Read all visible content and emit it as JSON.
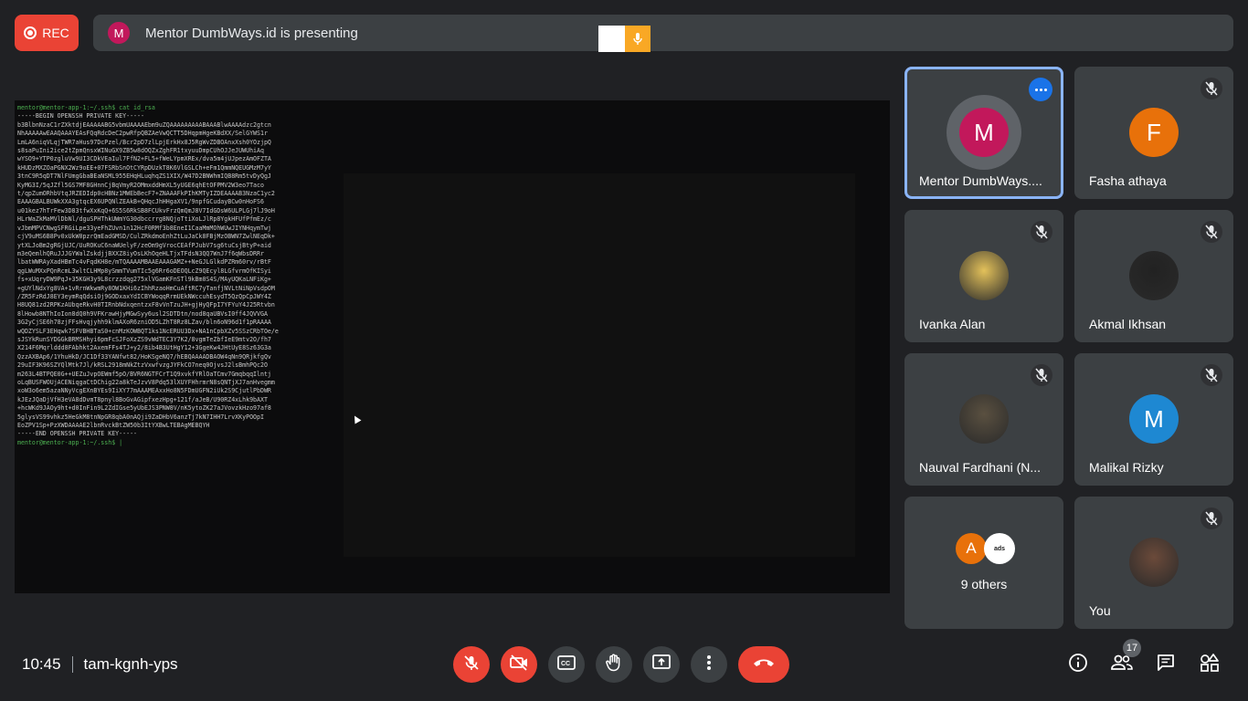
{
  "recording": {
    "label": "REC"
  },
  "presentation": {
    "presenter_initial": "M",
    "banner": "Mentor DumbWays.id is presenting"
  },
  "terminal": {
    "lines": [
      "mentor@mentor-app-1:~/.ssh$ cat id_rsa",
      "-----BEGIN OPENSSH PRIVATE KEY-----",
      "b3BlbnNzaC1rZXktdjEAAAAABG5vbmUAAAAEbm9uZQAAAAAAAAABAAABlwAAAAdzc2gtcn",
      "NhAAAAAwEAAQAAAYEAsFQqRdcDeC2pwRfpQBZAeVwQCTT5DHqpmHgeKBdXX/SelGYWS1r",
      "LmLA6niqVLqjTWR7aHus97DcPzel/Bcr2pD7zlLpjErkHx8J5RgWvZDBOAnxXsh0YOzjpQ",
      "s8saPuIni2ice2tZpmQnsxWINuGX9ZB5w8dOQZxZghFR1txyuuDmpCUhOJJeJUWUhiAq",
      "wYSO9+YTP0zgluVw9UI3CDkVEaIul7FfN2+FL5+fWeLYpmXREx/dva5m4jUJpezAmOFZTA",
      "kHUDzMXZOaPGNX2Wz9oEE+07FSRbSnOtCYRpDUzkT8K6VlGSLCh+eFm1QmmNQEUGMzM7yY",
      "3tnC9R5qDT7NlFUmgGbaBEaNSML955EHqHLuqhqZS1XIX/W47D2BNWhmIQB8Rm5tvDyQgJ",
      "KyMG3I/5qJZfl5GS7MF8GHnnCjBqVmyR2OMmxddHmXL5yUGE6qhEtOFPMV2W3eo7Taco",
      "t/qpZumORhbVtqJRZEDIdp0cHBNz1MWEbBecF7+ZNAAAFkPIhKMTyIZDEAAAAB3NzaC1yc2",
      "EAAAGBALBUWkXXA3gtqcEX6UPQNlZEAkB+QHqcJhHHgaXV1/9npfGCudayBCw0nHoFS6",
      "u01kez7hTrFew3D83tfwXxKqQ+6S5S6RkSB8FCUkvFrzQmQmJ8V7IdGDsW6ULPLGj7lJ9oH",
      "HLrWaZkMaMVlDbNl/dguSPHThkUWmYG30dbccrrg8NQjoTtiXoLJlRp8YgkHFUfPfmEz/c",
      "vJbmMPVCNwgSFRGiLpe33yeFhZUvn1n12HcF0RMf3b8EneI1CaaMmMOhWUwJIYNHqymTwj",
      "cjV9uMS6B8Pv0xUkW0pzrQmEadGMSD/CulZRkdmoEnhZtLuJaCk8FBjMzOBWN7ZwlNEqDk+",
      "ytXLJoBm2gRGjUJC/UuROKuC6naWUelyF/zeOm9gVrocCEAfPJubV7sg6tuCsjBtyP+aid",
      "m3eQemlhQRuJJJGYWalZskdjjBXXZ8iyOsLKhOqeHLTjxTFdsN3QQ7WnJ7f6qWbsDRRr",
      "lbatWWRAyXadHBmTc4vFqdKH8e/mTQAAAAMBAAEAAAGAMZ++NeGJLGlkdPZRm60rv/rBtF",
      "qgLWuMXxPQnRcmL3wltCLHMp8ySmmTVumTIc5g6Rr6oDEOQLcZ9QEcyl8LGfvrmOfKISyi",
      "fs+xUqryDW9PqJ+35KGH3y9L8crzzdqg275xlVGamKFnSTl9kBm0S4S/MAyUQKaLNFiKg+",
      "+gUYlNdxYg8VA+1vRrnWkwmRy8OW1KHi6zIhhRzaoHmCuAftRC7yTanfjNVLtNiNpVsdpOM",
      "/ZR5FzRdJ8EY3eymRqQdsiOj9GODxaxYdICBYWoqqRrmUEkNWccuhEsydT5QzQpCpJWY4Z",
      "H8UQ81zd2RPKzAUbqeRkvH0TIRnbNdxqentzxF8vVnTzuJH+gjHyQFpI7YFYuY4J25Rtvbn",
      "8lHowb8NThIoIon8dQ0h9VFKrawHjyMGwSyy6usl2SDTDtn/nod8qaUBVsI0ff4JQVVGA",
      "3G2yCjSE6h78zjFFsHvqjyhh9klmAXoR6zniOD5LZhT8Rz8LZav/bln6oN96d1f1pRAAAA",
      "wQDZYSLF3EHqwk7SFVBHBTaS0+cnMzKOWBQT1ks1NcERUU3Dx+NA1nCpbXZv5SSzCRbTOe/e",
      "sJSYkRunSYDGGkBRMSHhyi6pmFcSJFoXzZS9vWdTEC3Y7K2/8vgmTeZbfIeE9mtv2O/fh7",
      "X214F6Mqrlddd8FAbhkt2AxemFFs4TJ+y2/8ib4B3UtHgY12+3GgeKw4JHtUyE8Sz63G3a",
      "QzzAXBAp6/1YhuHkD/JC1Df33YANfwt82/HoKSgeNQ7/hEBQAAAADBAOW4qNn9QRjkfgQv",
      "29uIF3K96SZYQlMtk7Jl/kRSL2918mNkZtzVxwfvzgJYFkCO7neq0OjvsJ2lsBmhPQc2O",
      "m263L4BTPQE0G++UEZuJvpOEWmf5pO/BVR6NGTFCrT1Q9xvkfYRlOaTCmv7GmqbqqIlntj",
      "oLqBUSFWOUjACENiqgaCtDChig22a8kTeJzvV8Pdq53lXUYFHhrmrN8sQNTjXJ7anHvegmm",
      "xoW3o6em5azaNNyVcgEXnBYEs9IiXY77mAAAMEAxxHo8N5FDmUGFN2iUk2S9CjutlPbDWR",
      "kJEzJQaDjVfH3eVA8dDvmT8pnyl8BoGvAGipfxezHpg+121f/aJeB/U90RZ4xLhk9bAXT",
      "+hcWKd9JAOy9ht+d0InFin9L2ZdIGse5yUbEJS3PNW8V/nK5ytoZK27aJVovzkHzo97af8",
      "5glysVS99vhkz5HeGkM8tnNpGR8qbA0nAQji9ZaDHbV6anzTj7kN7IHH7LrvXKyPOOpI",
      "EoZPV1Sp+PzXWDAAAAE2lbnRvckBtZW50b3ItYXBwLTEBAgMEBQYH",
      "-----END OPENSSH PRIVATE KEY-----",
      "mentor@mentor-app-1:~/.ssh$ |"
    ]
  },
  "participants": [
    {
      "name": "Mentor DumbWays....",
      "initial": "M",
      "color": "#c2185b",
      "muted": false,
      "active": true
    },
    {
      "name": "Fasha athaya",
      "initial": "F",
      "color": "#e8710a",
      "muted": true
    },
    {
      "name": "Ivanka Alan",
      "initial": "",
      "color": "#e3c15a",
      "muted": true
    },
    {
      "name": "Akmal Ikhsan",
      "initial": "",
      "color": "#222222",
      "muted": true
    },
    {
      "name": "Nauval Fardhani (N...",
      "initial": "",
      "color": "#5a5040",
      "muted": true
    },
    {
      "name": "Malikal Rizky",
      "initial": "M",
      "color": "#1e88d2",
      "muted": true
    },
    {
      "name": "9 others",
      "initial": "A",
      "color": "#e8710a",
      "muted": false
    },
    {
      "name": "You",
      "initial": "",
      "color": "#6b4a3a",
      "muted": true
    }
  ],
  "others_second_avatar": "ads",
  "footer": {
    "time": "10:45",
    "meeting_code": "tam-kgnh-yps",
    "participant_count": "17"
  },
  "colors": {
    "accent": "#8ab4f8",
    "danger": "#ea4335",
    "tile": "#3c4043",
    "bg": "#202124"
  }
}
